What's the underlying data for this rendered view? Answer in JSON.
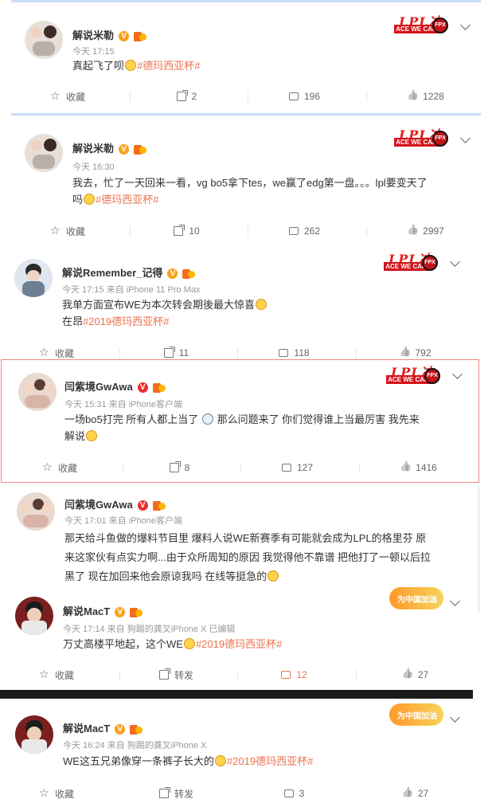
{
  "posts": [
    {
      "name": "解说米勒",
      "time": "今天 17:15",
      "text": "真起飞了呗",
      "tag": "#德玛西亚杯#",
      "actions": {
        "fav": "收藏",
        "forward": "2",
        "comment": "196",
        "like": "1228"
      }
    },
    {
      "name": "解说米勒",
      "time": "今天 16:30",
      "text_line1": "我去，忙了一天回来一看，vg bo5拿下tes，we赢了edg第一盘。。。lpl要变天了",
      "text_line2": "吗",
      "tag": "#德玛西亚杯#",
      "actions": {
        "fav": "收藏",
        "forward": "10",
        "comment": "262",
        "like": "2997"
      }
    },
    {
      "name": "解说Remember_记得",
      "time": "今天 17:15 来自 iPhone 11 Pro Max",
      "text_line1": "我单方面宣布WE为本次转会期後最大惊喜",
      "text_line2": "在昂",
      "tag": "#2019德玛西亚杯#",
      "actions": {
        "fav": "收藏",
        "forward": "11",
        "comment": "118",
        "like": "792"
      }
    },
    {
      "name": "闫紫境GwAwa",
      "time": "今天 15:31 来自 iPhone客户端",
      "text_line1a": "一场bo5打完 所有人都上当了",
      "text_line1b": "那么问题来了 你们觉得谁上当最厉害 我先来",
      "text_line2": "解说",
      "actions": {
        "fav": "收藏",
        "forward": "8",
        "comment": "127",
        "like": "1416"
      }
    },
    {
      "name": "闫紫境GwAwa",
      "time": "今天 17:01 来自 iPhone客户端",
      "text_line1": "那天给斗鱼做的爆料节目里 爆料人说WE新赛季有可能就会成为LPL的格里芬 原",
      "text_line2": "来这家伙有点实力啊...由于众所周知的原因 我觉得他不靠谱 把他打了一顿以后拉",
      "text_line3": "黑了 现在加回来他会原谅我吗 在线等挺急的"
    },
    {
      "name": "解说MacT",
      "time": "今天 17:14 来自 狗踢的龚叉iPhone X  已编辑",
      "text": "万丈高楼平地起，这个WE",
      "tag": "#2019德玛西亚杯#",
      "actions": {
        "fav": "收藏",
        "forward": "转发",
        "comment": "12",
        "like": "27"
      }
    },
    {
      "name": "解说MacT",
      "time": "今天 16:24 来自 狗踢的龚叉iPhone X",
      "text": "WE这五兄弟像穿一条裤子长大的",
      "tag": "#2019德玛西亚杯#",
      "actions": {
        "fav": "收藏",
        "forward": "转发",
        "comment": "3",
        "like": "27"
      }
    }
  ],
  "decor": {
    "lpl": "LPL冲",
    "ace": "ACE WE CAN",
    "fpx": "FPX",
    "flag": "为中国加油"
  },
  "badge_v": "V",
  "colors": {
    "tag": "#eb7350",
    "accent_red": "#d3141b"
  }
}
